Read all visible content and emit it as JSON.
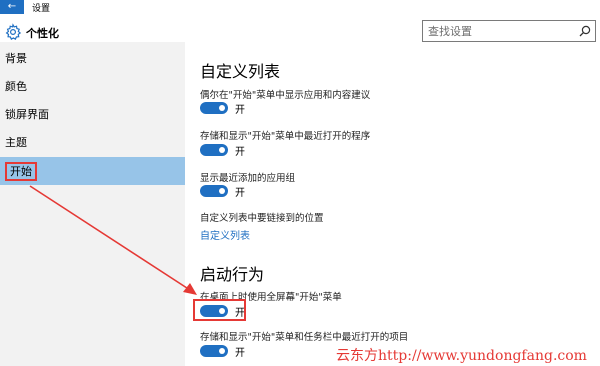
{
  "window": {
    "title": "设置",
    "back_glyph": "←"
  },
  "header": {
    "title": "个性化"
  },
  "search": {
    "placeholder": "查找设置"
  },
  "sidebar": {
    "items": [
      {
        "label": "背景"
      },
      {
        "label": "颜色"
      },
      {
        "label": "锁屏界面"
      },
      {
        "label": "主题"
      },
      {
        "label": "开始"
      }
    ],
    "active_index": 4
  },
  "main": {
    "customize_heading": "自定义列表",
    "settings1": [
      {
        "label": "偶尔在\"开始\"菜单中显示应用和内容建议",
        "state": "开"
      },
      {
        "label": "存储和显示\"开始\"菜单中最近打开的程序",
        "state": "开"
      },
      {
        "label": "显示最近添加的应用组",
        "state": "开"
      }
    ],
    "choose_folders_text": "自定义列表中要链接到的位置",
    "choose_folders_link": "自定义列表",
    "behavior_heading": "启动行为",
    "settings2": [
      {
        "label": "在桌面上时使用全屏幕\"开始\"菜单",
        "state": "开"
      },
      {
        "label": "存储和显示\"开始\"菜单和任务栏中最近打开的项目",
        "state": "开"
      }
    ]
  },
  "watermark": "云东方http://www.yundongfang.com",
  "colors": {
    "accent": "#1f6fc2",
    "annotation": "#e53935",
    "sidebar_bg": "#f2f2f2",
    "active_item": "#97c4e8"
  }
}
